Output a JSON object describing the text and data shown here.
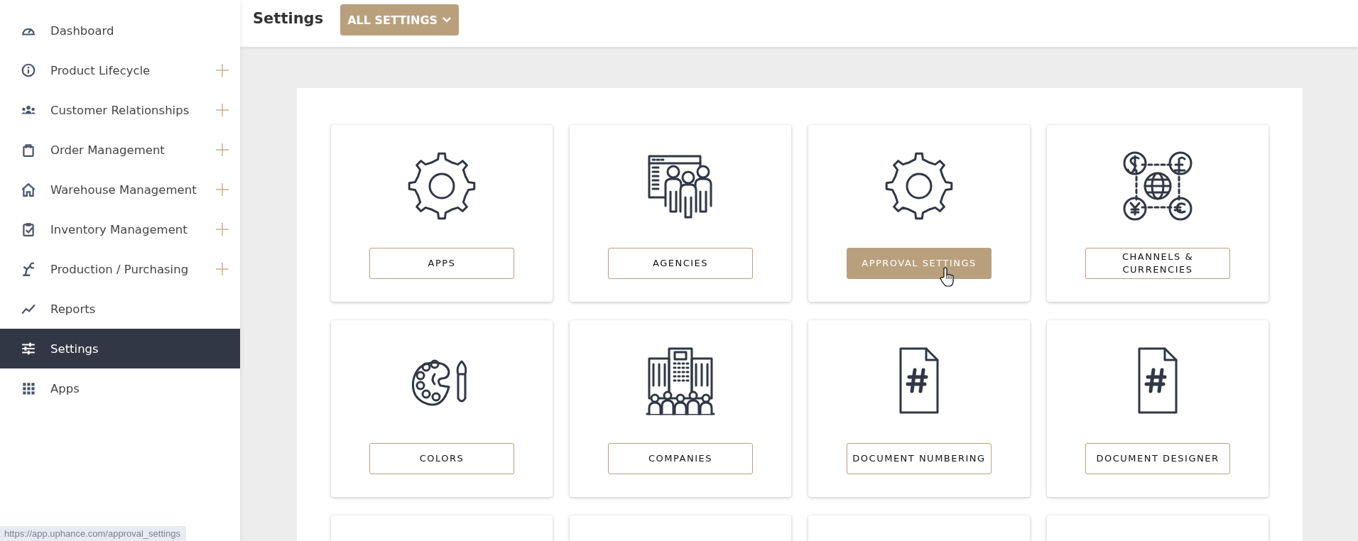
{
  "sidebar": {
    "items": [
      {
        "label": "Dashboard",
        "expandable": false,
        "selected": false
      },
      {
        "label": "Product Lifecycle",
        "expandable": true,
        "selected": false
      },
      {
        "label": "Customer Relationships",
        "expandable": true,
        "selected": false
      },
      {
        "label": "Order Management",
        "expandable": true,
        "selected": false
      },
      {
        "label": "Warehouse Management",
        "expandable": true,
        "selected": false
      },
      {
        "label": "Inventory Management",
        "expandable": true,
        "selected": false
      },
      {
        "label": "Production / Purchasing",
        "expandable": true,
        "selected": false
      },
      {
        "label": "Reports",
        "expandable": false,
        "selected": false
      },
      {
        "label": "Settings",
        "expandable": false,
        "selected": true
      },
      {
        "label": "Apps",
        "expandable": false,
        "selected": false
      }
    ]
  },
  "header": {
    "title": "Settings",
    "dropdown": "ALL SETTINGS"
  },
  "cards": [
    {
      "kind": "gear",
      "label": "APPS",
      "hovered": false
    },
    {
      "kind": "agency",
      "label": "AGENCIES",
      "hovered": false
    },
    {
      "kind": "gear",
      "label": "APPROVAL SETTINGS",
      "hovered": true
    },
    {
      "kind": "currency",
      "label": "CHANNELS & CURRENCIES",
      "hovered": false
    },
    {
      "kind": "palette",
      "label": "COLORS",
      "hovered": false
    },
    {
      "kind": "building",
      "label": "COMPANIES",
      "hovered": false
    },
    {
      "kind": "document",
      "label": "DOCUMENT NUMBERING",
      "hovered": false
    },
    {
      "kind": "document",
      "label": "DOCUMENT DESIGNER",
      "hovered": false
    }
  ],
  "status_bar": {
    "url": "https://app.uphance.com/approval_settings"
  }
}
